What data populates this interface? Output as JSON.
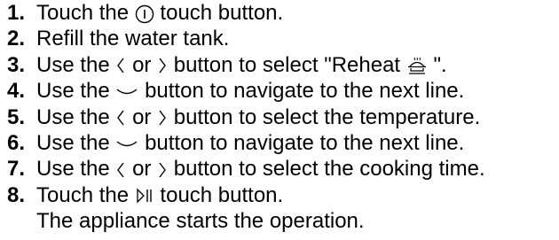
{
  "steps": [
    {
      "num": "1.",
      "pre": "Touch the",
      "icon": "power-icon",
      "post": "touch button."
    },
    {
      "num": "2.",
      "pre": "Refill the water tank.",
      "icon": "",
      "post": ""
    },
    {
      "num": "3.",
      "pre": "Use the",
      "icon": "left-right-arrows-icon",
      "post": "button to select \"Reheat",
      "tail_icon": "reheat-icon",
      "tail": "\"."
    },
    {
      "num": "4.",
      "pre": "Use the",
      "icon": "chevron-down-icon",
      "post": "button to navigate to the next line."
    },
    {
      "num": "5.",
      "pre": "Use the",
      "icon": "left-right-arrows-icon",
      "post": "button to select the temperature."
    },
    {
      "num": "6.",
      "pre": "Use the",
      "icon": "chevron-down-icon",
      "post": "button to navigate to the next line."
    },
    {
      "num": "7.",
      "pre": "Use the",
      "icon": "left-right-arrows-icon",
      "post": "button to select the cooking time."
    },
    {
      "num": "8.",
      "pre": "Touch the",
      "icon": "play-pause-icon",
      "post": "touch button."
    }
  ],
  "or_label": "or",
  "result_text": "The appliance starts the operation."
}
